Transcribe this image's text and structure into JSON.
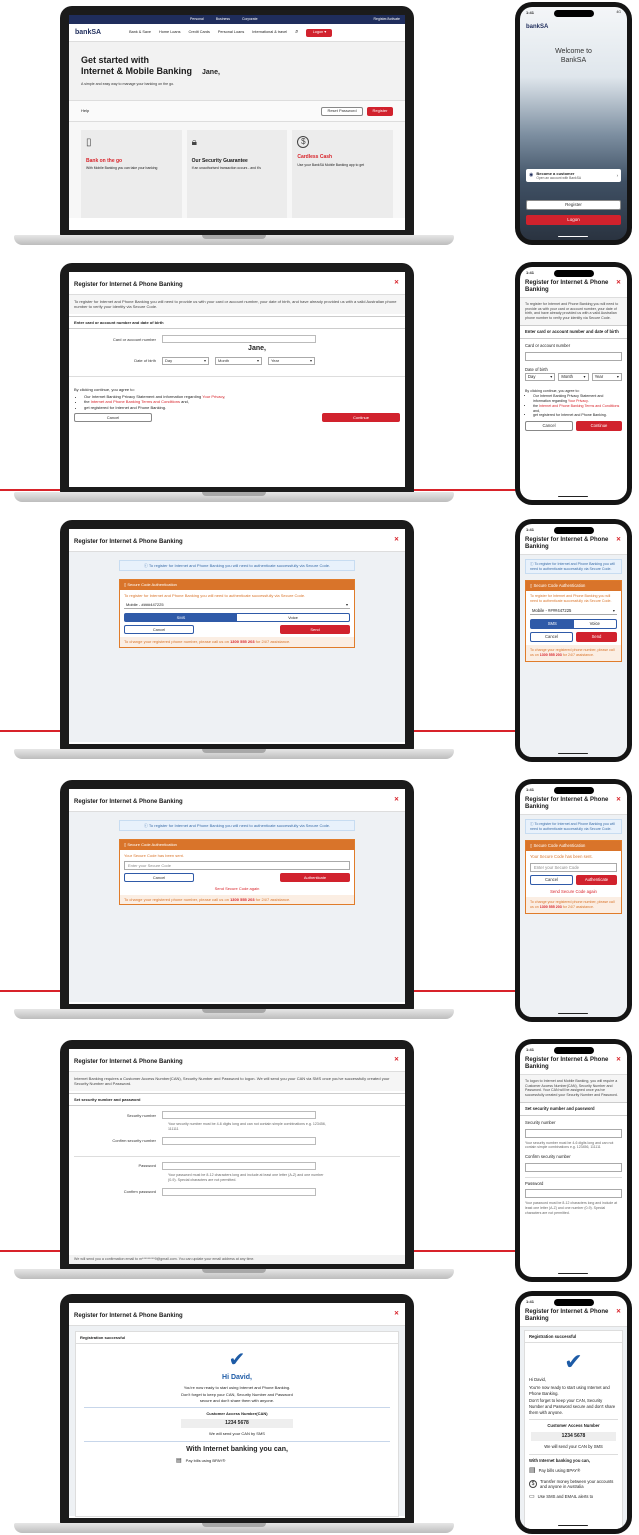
{
  "s1": {
    "nav_top": [
      "Personal",
      "Business",
      "Corporate"
    ],
    "nav_right": "Register/Activate",
    "logo": "bankSA",
    "nav_links": [
      "Bank & Save",
      "Home Loans",
      "Credit Cards",
      "Personal Loans",
      "International & travel"
    ],
    "logon": "Logon",
    "headline1": "Get started with",
    "headline2": "Internet & Mobile Banking",
    "name": "Jane,",
    "subtext": "A simple and easy way to manage your banking on the go.",
    "help": "Help",
    "reset": "Reset Password",
    "register": "Register",
    "cards": [
      {
        "icon": "phone-icon",
        "title": "Bank on the go",
        "text": "With Mobile Banking you can take your banking"
      },
      {
        "icon": "lock-icon",
        "title": "Our Security Guarantee",
        "text": "If an unauthorised transaction occurs - and it's"
      },
      {
        "icon": "dollar-icon",
        "title": "Cardless Cash",
        "text": "Use your BankSA Mobile Banking app to get"
      }
    ]
  },
  "p1": {
    "time": "1:41",
    "battery": "4G",
    "logo": "bankSA",
    "welcome1": "Welcome to",
    "welcome2": "BankSA",
    "become_title": "Become a customer",
    "become_sub": "Open an account with BankSA",
    "register": "Register",
    "logon": "Logon"
  },
  "s2": {
    "title": "Register for Internet & Phone Banking",
    "intro": "To register for Internet and Phone Banking you will need to provide us with your card or account number, your date of birth, and have already provided us with a valid Australian phone number to verify your identity via Secure Code.",
    "section": "Enter card or account number and date of birth",
    "card_label": "Card or account number",
    "name": "Jane,",
    "dob_label": "Date of birth",
    "day": "Day",
    "month": "Month",
    "year": "Year",
    "agree": "By clicking continue, you agree to:",
    "bullets": [
      {
        "pre": "Our Internet Banking Privacy Statement and information regarding ",
        "link": "Your Privacy",
        "post": ","
      },
      {
        "pre": "the ",
        "link": "Internet and Phone Banking Terms and Conditions",
        "post": " and,"
      },
      {
        "pre": "get registered for Internet and Phone Banking.",
        "link": "",
        "post": ""
      }
    ],
    "cancel": "Cancel",
    "continue": "Continue"
  },
  "p2": {
    "title": "Register for Internet & Phone Banking",
    "intro": "To register for Internet and Phone Banking you will need to provide us with your card or account number, your date of birth, and have already provided us with a valid Australian phone number to verify your identity via Secure Code.",
    "section": "Enter card or account number and date of birth",
    "card_label": "Card or account number",
    "dob_label": "Date of birth",
    "day": "Day",
    "month": "Month",
    "year": "Year",
    "agree": "By clicking continue, you agree to:",
    "bullets": [
      {
        "pre": "Our Internet Banking Privacy Statement and information regarding ",
        "link": "Your Privacy",
        "post": "."
      },
      {
        "pre": "the ",
        "link": "Internet and Phone Banking Terms and Conditions",
        "post": " and,"
      },
      {
        "pre": "get registered for Internet and Phone Banking.",
        "link": "",
        "post": ""
      }
    ],
    "cancel": "Cancel",
    "continue": "Continue"
  },
  "s3": {
    "title": "Register for Internet & Phone Banking",
    "info": "To register for Internet and Phone Banking you will need to authenticate successfully via Secure Code.",
    "card_title": "Secure Code Authentication",
    "card_text": "To register for Internet and Phone Banking you will need to authenticate successfully via Secure Code.",
    "mobile": "Mobile - ####447225",
    "sms": "SMS",
    "voice": "Voice",
    "cancel": "Cancel",
    "send": "Send",
    "footer_pre": "To change your registered phone number, please call us on ",
    "footer_phone": "1300 555 203",
    "footer_post": " for 24/7 assistance."
  },
  "s4": {
    "title": "Register for Internet & Phone Banking",
    "info": "To register for Internet and Phone Banking you will need to authenticate successfully via Secure Code.",
    "card_title": "Secure Code Authentication",
    "sent": "Your Secure Code has been sent.",
    "placeholder": "Enter your Secure Code",
    "cancel": "Cancel",
    "authenticate": "Authenticate",
    "again": "Send Secure Code again",
    "footer_pre": "To change your registered phone number, please call us on ",
    "footer_phone": "1300 555 203",
    "footer_post": " for 24/7 assistance."
  },
  "s5": {
    "title": "Register for Internet & Phone Banking",
    "intro": "Internet Banking requires a Customer Access Number(CAN), Security Number and Password to logon. We will send you your CAN via SMS once you've successfully created your Security Number and Password.",
    "section": "Set security number and password",
    "sec_label": "Security number",
    "sec_help": "Your security number must be 4-6 digits long and can not contain simple combinations e.g. 123456, 111111",
    "conf_sec_label": "Confirm security number",
    "pw_label": "Password",
    "pw_help": "Your password must be 8-12 characters long and include at least one letter (A-Z) and one number (0-9). Special characters are not permitted.",
    "conf_pw_label": "Confirm password",
    "footer": "We will send you a confirmation email to m*********9@gmail.com. You can update your email address at any time."
  },
  "p5": {
    "title": "Register for Internet & Phone Banking",
    "intro": "To logon to Internet and Mobile Banking, you will require a Customer Access Number(CAN), Security Number and Password. Your CAN will be assigned once you've successfully created your Security Number and Password.",
    "section": "Set security number and password",
    "sec_label": "Security number",
    "sec_help": "Your security number must be 4-6 digits long and can not contain simple combinations e.g. 123456, 111111",
    "conf_sec_label": "Confirm security number",
    "pw_label": "Password",
    "pw_help": "Your password must be 8-12 characters long and include at least one letter (A-Z) and one number (0-9). Special characters are not permitted."
  },
  "s6": {
    "title": "Register for Internet & Phone Banking",
    "status": "Registration successful",
    "hi": "Hi David,",
    "ready": "You're now ready to start using Internet and Phone Banking.",
    "keep": "Don't forget to keep your CAN, Security Number and Password secure and don't share them with anyone.",
    "can_label": "Customer Access Number(CAN)",
    "can": "1234 5678",
    "sms_note": "We will send your CAN by SMS",
    "with": "With Internet banking you can,",
    "feature": "Pay bills using BPAY®"
  },
  "p6": {
    "title": "Register for Internet & Phone Banking",
    "status": "Registration successful",
    "hi": "Hi David,",
    "ready": "You're now ready to start using Internet and Phone Banking.",
    "keep": "Don't forget to keep your CAN, Security Number and Password secure and don't share them with anyone.",
    "can_label": "Customer Access Number",
    "can": "1234 5678",
    "sms_note": "We will send your CAN by SMS",
    "with": "With Internet banking you can,",
    "features": [
      "Pay bills using BPAY®",
      "Transfer money between your accounts and anyone in Australia",
      "Use SMS and EMAIL alerts to"
    ]
  }
}
